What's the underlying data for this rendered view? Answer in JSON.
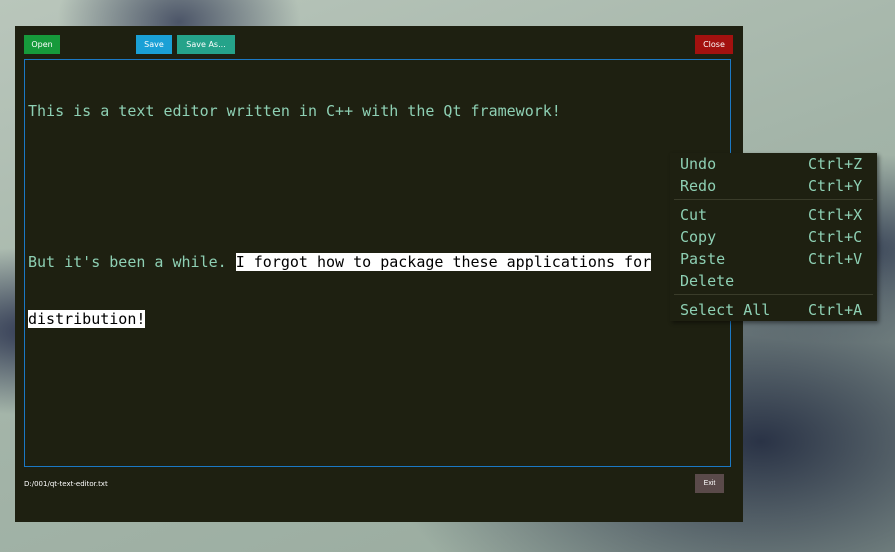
{
  "toolbar": {
    "open_label": "Open",
    "save_label": "Save",
    "save_as_label": "Save As...",
    "close_label": "Close"
  },
  "editor": {
    "line1": "This is a text editor written in C++ with the Qt framework!",
    "line2_plain": "But it's been a while. ",
    "line2_selected": "I forgot how to package these applications for",
    "line3_selected": "distribution!"
  },
  "status": {
    "file_path": "D:/001/qt-text-editor.txt",
    "exit_label": "Exit"
  },
  "context_menu": {
    "items": [
      {
        "label": "Undo",
        "shortcut": "Ctrl+Z"
      },
      {
        "label": "Redo",
        "shortcut": "Ctrl+Y"
      },
      {
        "label": "Cut",
        "shortcut": "Ctrl+X"
      },
      {
        "label": "Copy",
        "shortcut": "Ctrl+C"
      },
      {
        "label": "Paste",
        "shortcut": "Ctrl+V"
      },
      {
        "label": "Delete",
        "shortcut": ""
      },
      {
        "label": "Select All",
        "shortcut": "Ctrl+A"
      }
    ]
  },
  "colors": {
    "window_bg": "#1e2011",
    "text": "#8ed0b4",
    "open": "#169a3b",
    "save": "#1aa0d6",
    "save_as": "#25a38a",
    "close": "#a3110f",
    "exit": "#5a4a4a",
    "editor_border": "#1b78c4"
  }
}
